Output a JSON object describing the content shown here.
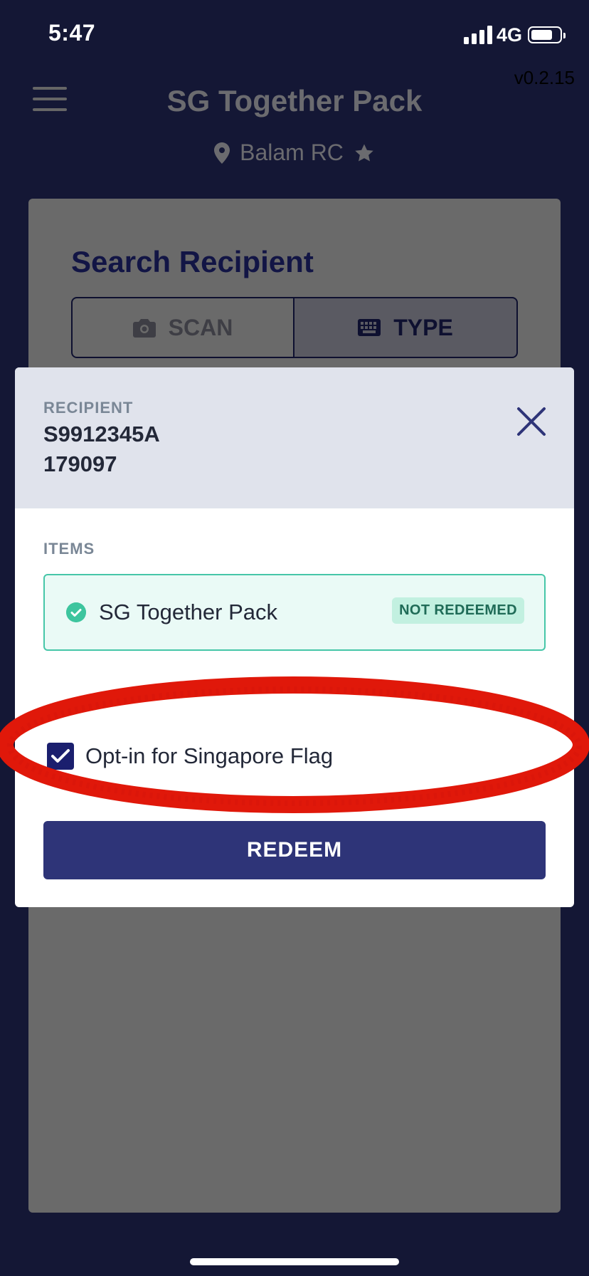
{
  "status_bar": {
    "time": "5:47",
    "network": "4G"
  },
  "header": {
    "title": "SG Together Pack",
    "version": "v0.2.15",
    "location": "Balam RC",
    "icons": {
      "menu": "hamburger-menu-icon",
      "location": "location-pin-icon",
      "favorite": "star-icon"
    }
  },
  "search": {
    "title": "Search Recipient",
    "tabs": [
      {
        "label": "SCAN",
        "icon": "camera-icon",
        "selected": false
      },
      {
        "label": "TYPE",
        "icon": "keyboard-icon",
        "selected": true
      }
    ]
  },
  "modal": {
    "recipient_label": "RECIPIENT",
    "recipient_id": "S9912345A",
    "recipient_code": "179097",
    "close_icon": "close-icon",
    "items_label": "ITEMS",
    "items": [
      {
        "name": "SG Together Pack",
        "status": "NOT REDEEMED",
        "icon": "check-circle-icon"
      }
    ],
    "opt_in": {
      "label": "Opt-in for Singapore Flag",
      "checked": true
    },
    "redeem_label": "REDEEM"
  },
  "colors": {
    "background": "#141735",
    "primary_button": "#2e3478",
    "item_border": "#46c6a8",
    "badge_bg": "#c2f0e0",
    "highlight": "#e0180a"
  }
}
